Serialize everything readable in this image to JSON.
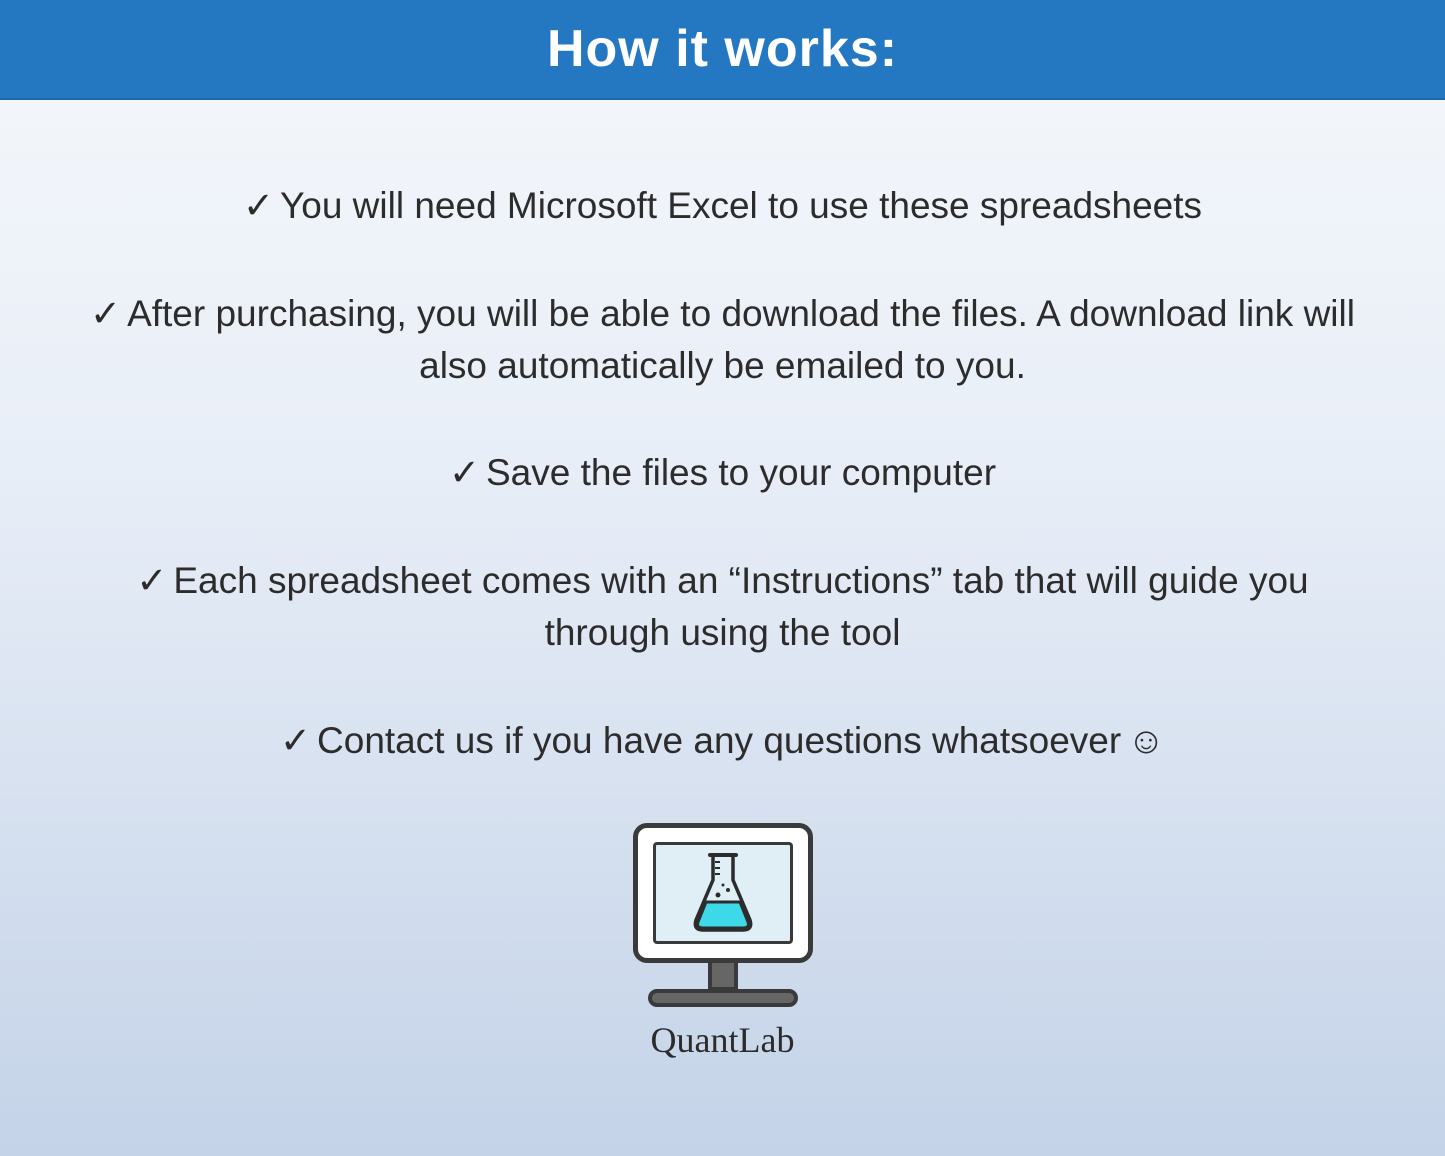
{
  "header": {
    "title": "How it works:"
  },
  "bullets": {
    "item1": "You will need Microsoft Excel to use these spreadsheets",
    "item2": "After purchasing, you will be able to download the files. A download link will also automatically be emailed to you.",
    "item3": "Save the files to your computer",
    "item4": "Each spreadsheet comes with an “Instructions” tab that will guide you through using the tool",
    "item5": "Contact us if you have any questions whatsoever"
  },
  "icons": {
    "check": "✓",
    "smile": "☺"
  },
  "brand": {
    "name": "QuantLab"
  }
}
